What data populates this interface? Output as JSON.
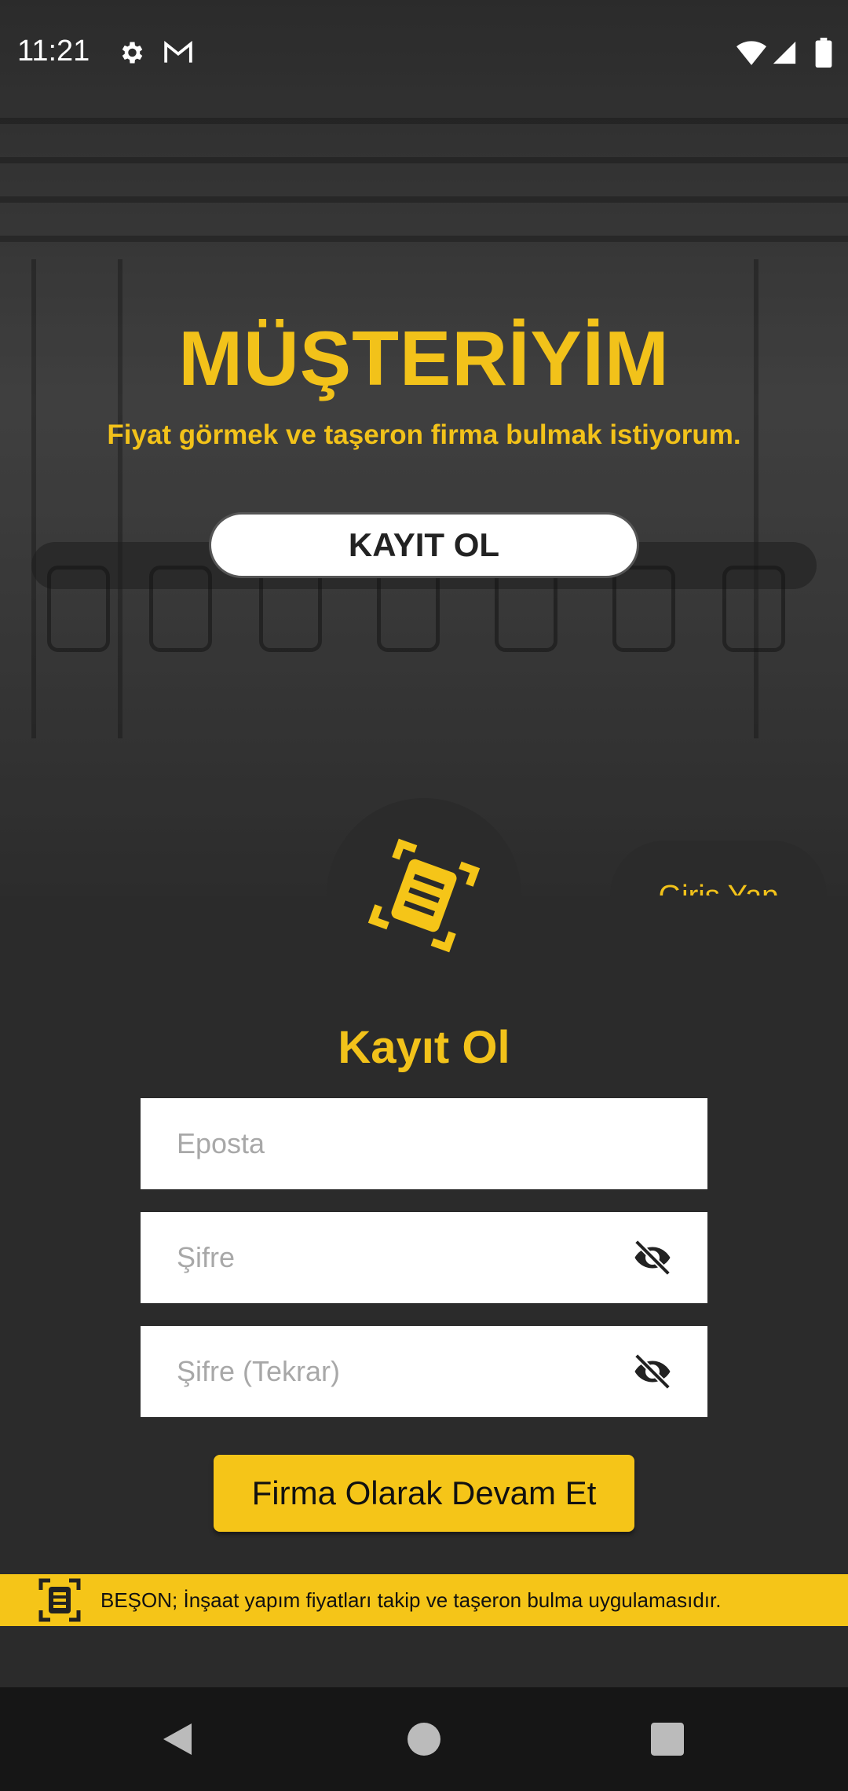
{
  "status_bar": {
    "time": "11:21",
    "icons": [
      "gear-icon",
      "gmail-icon",
      "wifi-icon",
      "signal-icon",
      "battery-icon"
    ]
  },
  "hero": {
    "title": "MÜŞTERİYİM",
    "subtitle": "Fiyat görmek ve taşeron firma bulmak istiyorum.",
    "register_button": "KAYIT OL"
  },
  "panel": {
    "login_tab": "Giriş Yap",
    "form_title": "Kayıt Ol",
    "fields": {
      "email_placeholder": "Eposta",
      "password_placeholder": "Şifre",
      "password_repeat_placeholder": "Şifre (Tekrar)"
    },
    "company_button": "Firma Olarak Devam Et"
  },
  "banner": {
    "text": "BEŞON; İnşaat yapım fiyatları takip ve taşeron bulma uygulamasıdır."
  },
  "colors": {
    "accent": "#f2c21a",
    "button_yellow": "#f5c518",
    "panel": "#2b2b2b"
  },
  "navbar": {
    "icons": [
      "back-icon",
      "home-icon",
      "recents-icon"
    ]
  }
}
